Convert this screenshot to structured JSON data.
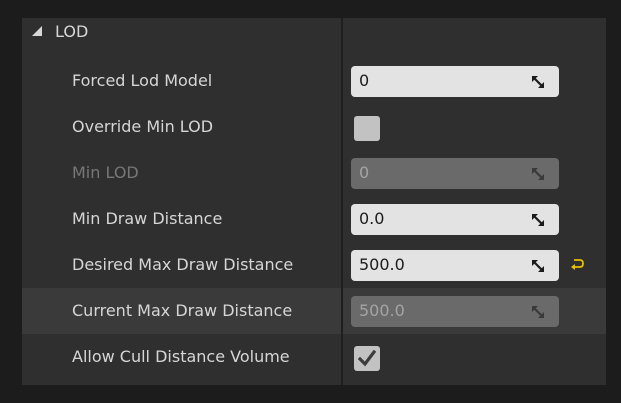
{
  "section": {
    "title": "LOD"
  },
  "rows": [
    {
      "label": "Forced Lod Model",
      "value": "0"
    },
    {
      "label": "Override Min LOD",
      "checked": false
    },
    {
      "label": "Min LOD",
      "value": "0",
      "disabled": true
    },
    {
      "label": "Min Draw Distance",
      "value": "0.0"
    },
    {
      "label": "Desired Max Draw Distance",
      "value": "500.0",
      "reset_icon": "reset-to-default-icon"
    },
    {
      "label": "Current Max Draw Distance",
      "value": "500.0",
      "disabled": true
    },
    {
      "label": "Allow Cull Distance Volume",
      "checked": true
    }
  ],
  "colors": {
    "panel": "#2f2f2f",
    "field": "#e3e3e3",
    "field_disabled": "#6a6a6a",
    "reset_icon": "#e8c000"
  }
}
